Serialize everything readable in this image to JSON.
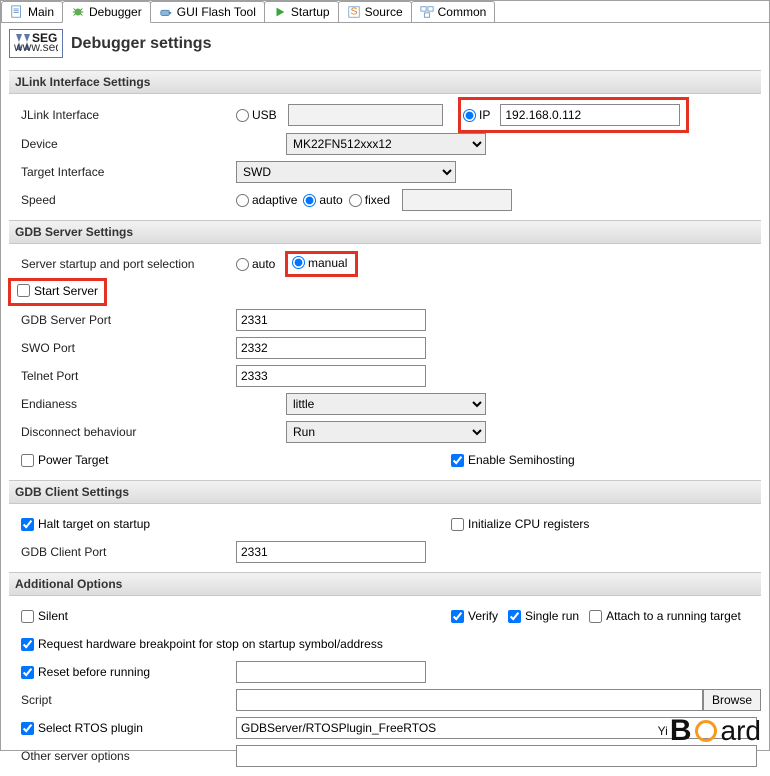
{
  "tabs": {
    "main": "Main",
    "debugger": "Debugger",
    "gui_flash": "GUI Flash Tool",
    "startup": "Startup",
    "source": "Source",
    "common": "Common"
  },
  "header": {
    "logo_top": "SEGGER",
    "logo_bottom": "www.segger.com",
    "title": "Debugger settings"
  },
  "jlink": {
    "section": "JLink Interface Settings",
    "interface_label": "JLink Interface",
    "usb": "USB",
    "usb_value": "",
    "ip": "IP",
    "ip_value": "192.168.0.112",
    "device_label": "Device",
    "device_value": "MK22FN512xxx12",
    "target_if_label": "Target Interface",
    "target_if_value": "SWD",
    "speed_label": "Speed",
    "adaptive": "adaptive",
    "auto": "auto",
    "fixed": "fixed",
    "fixed_value": ""
  },
  "gdbserver": {
    "section": "GDB Server Settings",
    "startup_label": "Server startup and port selection",
    "auto": "auto",
    "manual": "manual",
    "start_server": "Start Server",
    "port_label": "GDB Server Port",
    "port": "2331",
    "swo_label": "SWO Port",
    "swo": "2332",
    "telnet_label": "Telnet Port",
    "telnet": "2333",
    "endian_label": "Endianess",
    "endian": "little",
    "disconnect_label": "Disconnect behaviour",
    "disconnect": "Run",
    "power_target": "Power Target",
    "semihosting": "Enable Semihosting"
  },
  "gdbclient": {
    "section": "GDB Client Settings",
    "halt": "Halt target on startup",
    "init_cpu": "Initialize CPU registers",
    "port_label": "GDB Client Port",
    "port": "2331"
  },
  "addl": {
    "section": "Additional Options",
    "silent": "Silent",
    "verify": "Verify",
    "single_run": "Single run",
    "attach": "Attach to a running target",
    "req_hw_bp": "Request hardware breakpoint for stop on startup symbol/address",
    "reset_label": "Reset before running",
    "reset_value": "",
    "script_label": "Script",
    "script_value": "",
    "browse": "Browse",
    "rtos_label": "Select RTOS plugin",
    "rtos_value": "GDBServer/RTOSPlugin_FreeRTOS",
    "other_label": "Other server options",
    "other_value": ""
  },
  "watermark": {
    "pre": "Yi",
    "post": "Board"
  }
}
